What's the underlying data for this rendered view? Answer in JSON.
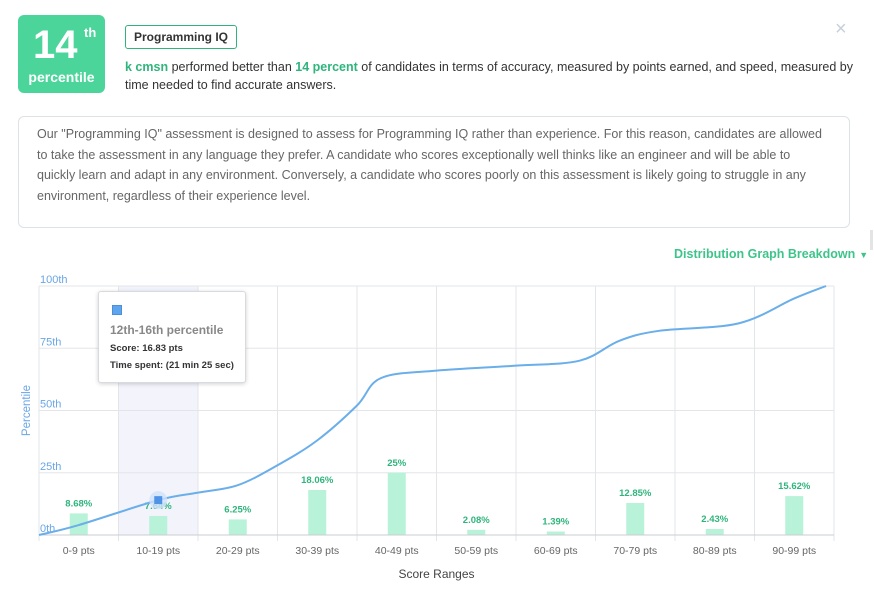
{
  "header": {
    "percentile_value": "14",
    "percentile_suffix": "th",
    "percentile_label": "percentile",
    "assessment_tag": "Programming IQ",
    "candidate_name": "k cmsn",
    "summary_mid": " performed better than ",
    "summary_percent": "14 percent",
    "summary_end": " of candidates in terms of accuracy, measured by points earned, and speed, measured by time needed to find accurate answers.",
    "close_icon": "×"
  },
  "description": "Our \"Programming IQ\" assessment is designed to assess for Programming IQ rather than experience. For this reason, candidates are allowed to take the assessment in any language they prefer. A candidate who scores exceptionally well thinks like an engineer and will be able to quickly learn and adapt in any environment. Conversely, a candidate who scores poorly on this assessment is likely going to struggle in any environment, regardless of their experience level.",
  "distribution_toggle": "Distribution Graph Breakdown",
  "tooltip": {
    "title": "12th-16th percentile",
    "score": "Score: 16.83 pts",
    "time": "Time spent: (21 min 25 sec)"
  },
  "colors": {
    "accent": "#4cd59b",
    "bar": "#b8f2d8",
    "line": "#6aaeea",
    "label_green": "#2fb57c"
  },
  "chart_data": {
    "type": "bar",
    "xlabel": "Score Ranges",
    "ylabel": "Percentile",
    "y_ticks": [
      "0th",
      "25th",
      "50th",
      "75th",
      "100th"
    ],
    "ylim": [
      0,
      100
    ],
    "categories": [
      "0-9 pts",
      "10-19 pts",
      "20-29 pts",
      "30-39 pts",
      "40-49 pts",
      "50-59 pts",
      "60-69 pts",
      "70-79 pts",
      "80-89 pts",
      "90-99 pts"
    ],
    "bar_values": [
      8.68,
      7.64,
      6.25,
      18.06,
      25,
      2.08,
      1.39,
      12.85,
      2.43,
      15.62
    ],
    "bar_labels": [
      "8.68%",
      "7.64%",
      "6.25%",
      "18.06%",
      "25%",
      "2.08%",
      "1.39%",
      "12.85%",
      "2.43%",
      "15.62%"
    ],
    "highlighted_category": 1,
    "curve": [
      [
        0,
        0
      ],
      [
        5,
        4
      ],
      [
        15,
        14
      ],
      [
        20,
        17
      ],
      [
        25,
        20
      ],
      [
        30,
        28
      ],
      [
        35,
        38
      ],
      [
        40,
        52
      ],
      [
        43,
        63
      ],
      [
        50,
        66
      ],
      [
        60,
        68
      ],
      [
        68,
        70
      ],
      [
        73,
        78
      ],
      [
        78,
        82
      ],
      [
        88,
        85
      ],
      [
        95,
        95
      ],
      [
        99,
        100
      ]
    ],
    "marker_point": [
      15,
      14
    ],
    "grid": true
  }
}
